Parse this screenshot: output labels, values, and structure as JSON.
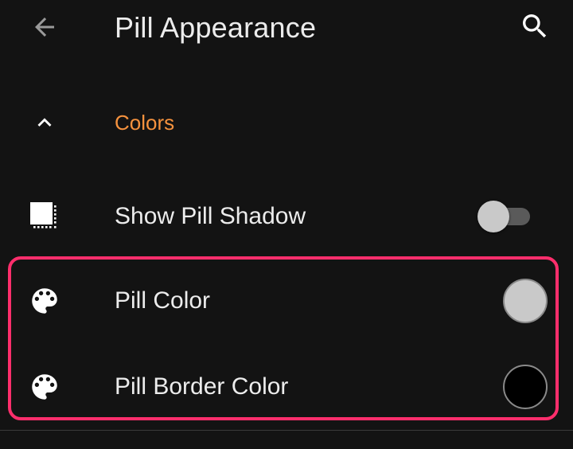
{
  "app_bar": {
    "title": "Pill Appearance",
    "back_icon": "arrow-back-icon",
    "search_icon": "search-icon"
  },
  "section": {
    "title": "Colors",
    "expanded": true,
    "chevron_icon": "chevron-up-icon",
    "accent_color": "#f5923e"
  },
  "settings": [
    {
      "label": "Show Pill Shadow",
      "icon": "shadow-icon",
      "control": "toggle",
      "enabled": false
    },
    {
      "label": "Pill Color",
      "icon": "palette-icon",
      "control": "color",
      "color": "#c9c9c9"
    },
    {
      "label": "Pill Border Color",
      "icon": "palette-icon",
      "control": "color",
      "color": "#000000"
    }
  ],
  "highlight": {
    "color": "#ff2e6c"
  }
}
